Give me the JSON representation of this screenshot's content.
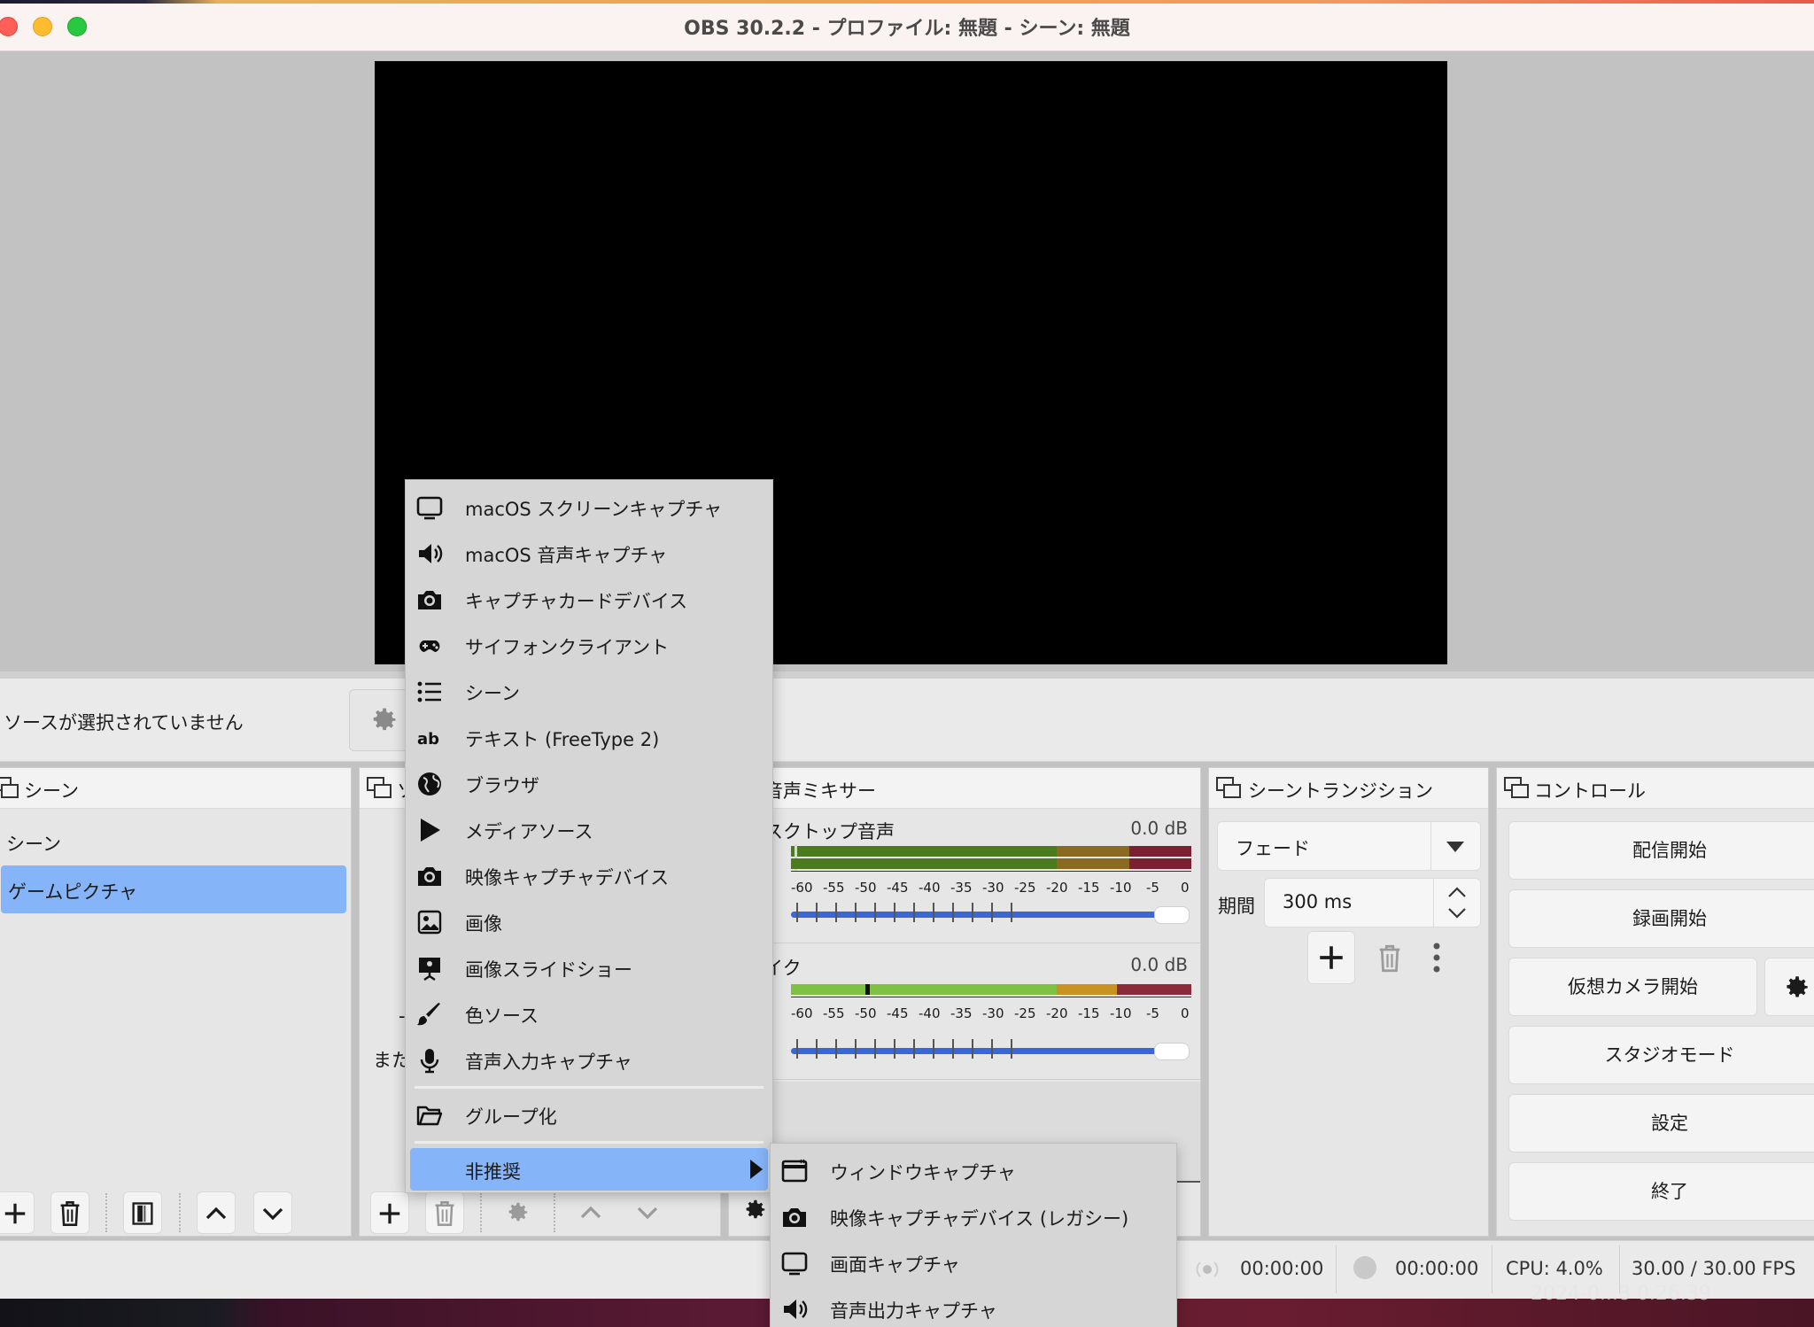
{
  "window": {
    "title": "OBS 30.2.2 - プロファイル: 無題 - シーン: 無題"
  },
  "context_bar": {
    "no_source": "ソースが選択されていません"
  },
  "scenes": {
    "title": "シーン",
    "items": [
      "シーン",
      "ゲームピクチャ"
    ]
  },
  "sources": {
    "title_fragment": "ソ",
    "hint_fragment": "また",
    "hint_fragment2": "-"
  },
  "mixer": {
    "title": "音声ミキサー",
    "channels": [
      {
        "name": "スクトップ音声",
        "db": "0.0 dB"
      },
      {
        "name": "イク",
        "db": "0.0 dB"
      }
    ],
    "scale": [
      "-60",
      "-55",
      "-50",
      "-45",
      "-40",
      "-35",
      "-30",
      "-25",
      "-20",
      "-15",
      "-10",
      "-5",
      "0"
    ]
  },
  "transitions": {
    "title": "シーントランジション",
    "selected": "フェード",
    "duration_label": "期間",
    "duration": "300 ms"
  },
  "controls": {
    "title": "コントロール",
    "start_stream": "配信開始",
    "start_record": "録画開始",
    "start_vcam": "仮想カメラ開始",
    "studio_mode": "スタジオモード",
    "settings": "設定",
    "exit": "終了"
  },
  "status": {
    "stream_time": "00:00:00",
    "record_time": "00:00:00",
    "cpu": "CPU: 4.0%",
    "fps": "30.00 / 30.00 FPS"
  },
  "desktop": {
    "clock_fragment": "2024-0...8 0.26.39"
  },
  "menu": {
    "items": [
      {
        "label": "macOS スクリーンキャプチャ",
        "icon": "monitor-icon"
      },
      {
        "label": "macOS 音声キャプチャ",
        "icon": "speaker-icon"
      },
      {
        "label": "キャプチャカードデバイス",
        "icon": "camera-icon"
      },
      {
        "label": "サイフォンクライアント",
        "icon": "gamepad-icon"
      },
      {
        "label": "シーン",
        "icon": "list-icon"
      },
      {
        "label": "テキスト (FreeType 2)",
        "icon": "text-ab-icon"
      },
      {
        "label": "ブラウザ",
        "icon": "globe-icon"
      },
      {
        "label": "メディアソース",
        "icon": "play-icon"
      },
      {
        "label": "映像キャプチャデバイス",
        "icon": "camera-icon"
      },
      {
        "label": "画像",
        "icon": "image-icon"
      },
      {
        "label": "画像スライドショー",
        "icon": "slideshow-icon"
      },
      {
        "label": "色ソース",
        "icon": "brush-icon"
      },
      {
        "label": "音声入力キャプチャ",
        "icon": "microphone-icon"
      }
    ],
    "group": {
      "label": "グループ化",
      "icon": "folder-icon"
    },
    "deprecated": {
      "label": "非推奨"
    }
  },
  "submenu": {
    "items": [
      {
        "label": "ウィンドウキャプチャ",
        "icon": "window-icon"
      },
      {
        "label": "映像キャプチャデバイス (レガシー)",
        "icon": "camera-icon"
      },
      {
        "label": "画面キャプチャ",
        "icon": "monitor-icon"
      },
      {
        "label": "音声出力キャプチャ",
        "icon": "speaker-icon"
      }
    ]
  },
  "colors": {
    "highlight": "#86b4f9",
    "slider": "#3b66d8",
    "meter_green": "#4a7c1f",
    "meter_yellow": "#c89320",
    "meter_red": "#7a2030"
  }
}
